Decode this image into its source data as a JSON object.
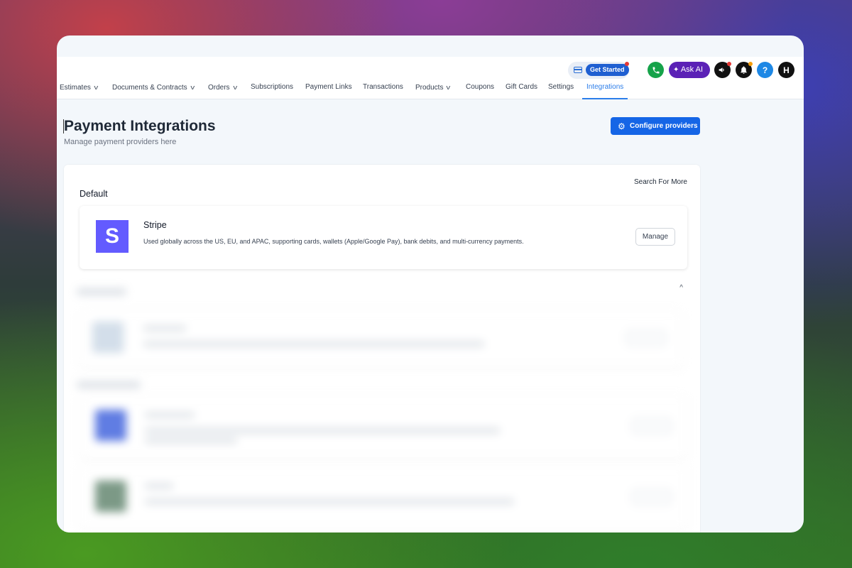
{
  "header": {
    "get_started": "Get Started",
    "ask_ai": "Ask AI",
    "help_glyph": "?",
    "avatar_initial": "H",
    "icons": [
      "card-icon",
      "phone-icon",
      "sparkle-icon",
      "megaphone-icon",
      "bell-icon",
      "help-icon"
    ]
  },
  "nav": {
    "items": [
      {
        "label": "Estimates",
        "dropdown": true
      },
      {
        "label": "Documents & Contracts",
        "dropdown": true
      },
      {
        "label": "Orders",
        "dropdown": true
      },
      {
        "label": "Subscriptions",
        "dropdown": false
      },
      {
        "label": "Payment Links",
        "dropdown": false
      },
      {
        "label": "Transactions",
        "dropdown": false
      },
      {
        "label": "Products",
        "dropdown": true
      },
      {
        "label": "Coupons",
        "dropdown": false
      },
      {
        "label": "Gift Cards",
        "dropdown": false
      },
      {
        "label": "Settings",
        "dropdown": false
      },
      {
        "label": "Integrations",
        "dropdown": false,
        "active": true
      }
    ]
  },
  "page": {
    "title": "Payment Integrations",
    "subtitle": "Manage payment providers here",
    "configure_label": "Configure providers"
  },
  "panel": {
    "search_more": "Search For More",
    "default_section": "Default",
    "default_provider": {
      "logo_letter": "S",
      "name": "Stripe",
      "description": "Used globally across the US, EU, and APAC, supporting cards, wallets (Apple/Google Pay), bank debits, and multi-currency payments.",
      "manage_label": "Manage"
    }
  },
  "colors": {
    "primary": "#1565e6",
    "active_tab": "#2b7de9",
    "stripe": "#635bff",
    "ask_ai": "#5b21b6",
    "phone": "#16a34a"
  }
}
